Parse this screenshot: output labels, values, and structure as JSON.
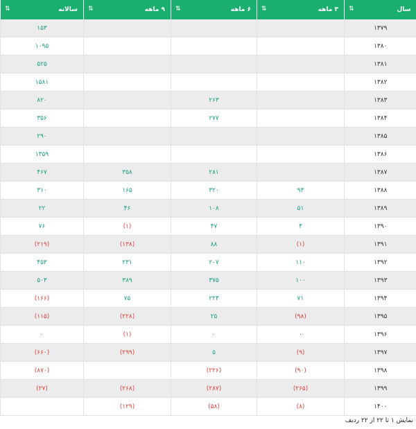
{
  "table": {
    "headers": {
      "year": "سال",
      "q3": "۳ ماهه",
      "q6": "۶ ماهه",
      "q9": "۹ ماهه",
      "annual": "سالانه"
    },
    "rows": [
      {
        "year": "۱۳۷۹",
        "q3": "",
        "q6": "",
        "q9": "",
        "annual": "۱۵۳"
      },
      {
        "year": "۱۳۸۰",
        "q3": "",
        "q6": "",
        "q9": "",
        "annual": "۱۰۹۵"
      },
      {
        "year": "۱۳۸۱",
        "q3": "",
        "q6": "",
        "q9": "",
        "annual": "۵۲۵"
      },
      {
        "year": "۱۳۸۲",
        "q3": "",
        "q6": "",
        "q9": "",
        "annual": "۱۵۸۱"
      },
      {
        "year": "۱۳۸۳",
        "q3": "",
        "q6": "۲۶۳",
        "q9": "",
        "annual": "۸۲۰"
      },
      {
        "year": "۱۳۸۴",
        "q3": "",
        "q6": "۲۷۷",
        "q9": "",
        "annual": "۳۵۶"
      },
      {
        "year": "۱۳۸۵",
        "q3": "",
        "q6": "",
        "q9": "",
        "annual": "۲۹۰"
      },
      {
        "year": "۱۳۸۶",
        "q3": "",
        "q6": "",
        "q9": "",
        "annual": "۱۳۵۹"
      },
      {
        "year": "۱۳۸۷",
        "q3": "",
        "q6": "۲۸۱",
        "q9": "۳۵۸",
        "annual": "۴۶۷"
      },
      {
        "year": "۱۳۸۸",
        "q3": "۹۳",
        "q6": "۳۲۰",
        "q9": "۱۶۵",
        "annual": "۳۱۰"
      },
      {
        "year": "۱۳۸۹",
        "q3": "۵۱",
        "q6": "۱۰۸",
        "q9": "۴۶",
        "annual": "۲۲"
      },
      {
        "year": "۱۳۹۰",
        "q3": "۴",
        "q6": "۴۷",
        "q9": "(۱)",
        "annual": "۷۶"
      },
      {
        "year": "۱۳۹۱",
        "q3": "(۱)",
        "q6": "۸۸",
        "q9": "(۱۳۸)",
        "annual": "(۲۱۹)"
      },
      {
        "year": "۱۳۹۲",
        "q3": "۱۱۰",
        "q6": "۲۰۷",
        "q9": "۲۳۱",
        "annual": "۴۵۳"
      },
      {
        "year": "۱۳۹۳",
        "q3": "۱۰۰",
        "q6": "۳۷۵",
        "q9": "۳۸۹",
        "annual": "۵۰۳"
      },
      {
        "year": "۱۳۹۴",
        "q3": "۷۱",
        "q6": "۲۲۳",
        "q9": "۷۵",
        "annual": "(۱۶۶)"
      },
      {
        "year": "۱۳۹۵",
        "q3": "(۹۸)",
        "q6": "۲۵",
        "q9": "(۲۲۸)",
        "annual": "(۱۱۵)"
      },
      {
        "year": "۱۳۹۶",
        "q3": "۰",
        "q6": "۰",
        "q9": "(۱)",
        "annual": "۰"
      },
      {
        "year": "۱۳۹۷",
        "q3": "(۹)",
        "q6": "۵",
        "q9": "(۲۹۹)",
        "annual": "(۶۶۰)"
      },
      {
        "year": "۱۳۹۸",
        "q3": "(۹۰)",
        "q6": "(۲۲۶)",
        "q9": "",
        "annual": "(۸۷۰)"
      },
      {
        "year": "۱۳۹۹",
        "q3": "(۲۶۵)",
        "q6": "(۲۸۷)",
        "q9": "(۲۶۸)",
        "annual": "(۲۷)"
      },
      {
        "year": "۱۴۰۰",
        "q3": "(۸)",
        "q6": "(۵۸)",
        "q9": "(۱۲۹)",
        "annual": ""
      }
    ]
  },
  "footer": {
    "info": "نمایش ۱ تا ۲۲ از ۲۲ ردیف"
  },
  "colors": {
    "header_bg": "#1aaf6e",
    "positive": "#17a084",
    "negative": "#e0413a",
    "stripe": "#ececec"
  },
  "icons": {
    "sort": "sort-arrows-icon"
  }
}
